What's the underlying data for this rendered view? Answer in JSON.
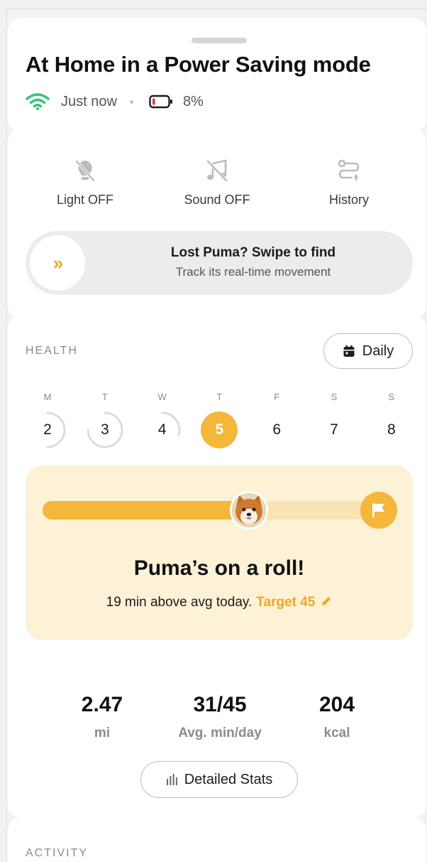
{
  "header": {
    "title": "At Home in a Power Saving mode",
    "updated": "Just now",
    "battery": "8%"
  },
  "controls": [
    {
      "label": "Light OFF",
      "icon": "light-off-icon"
    },
    {
      "label": "Sound OFF",
      "icon": "sound-off-icon"
    },
    {
      "label": "History",
      "icon": "history-icon"
    }
  ],
  "swipe": {
    "title": "Lost Puma? Swipe to find",
    "subtitle": "Track its real-time movement",
    "arrows": "»"
  },
  "health": {
    "label": "HEALTH",
    "period_button": "Daily",
    "days": [
      {
        "dow": "M",
        "num": "2",
        "progress": 0.5
      },
      {
        "dow": "T",
        "num": "3",
        "progress": 0.75
      },
      {
        "dow": "W",
        "num": "4",
        "progress": 0.3
      },
      {
        "dow": "T",
        "num": "5",
        "progress": 1.0,
        "active": true
      },
      {
        "dow": "F",
        "num": "6",
        "progress": 0
      },
      {
        "dow": "S",
        "num": "7",
        "progress": 0
      },
      {
        "dow": "S",
        "num": "8",
        "progress": 0
      }
    ],
    "goal_progress": 0.62,
    "roll_title": "Puma’s on a roll!",
    "roll_subtitle": "19 min above avg today.",
    "target": "Target 45",
    "stats": [
      {
        "value": "2.47",
        "unit": "mi"
      },
      {
        "value": "31/45",
        "unit": "Avg. min/day"
      },
      {
        "value": "204",
        "unit": "kcal"
      }
    ],
    "detail_button": "Detailed Stats"
  },
  "activity": {
    "label": "ACTIVITY"
  },
  "colors": {
    "accent": "#f4b73a",
    "accent_text": "#f0a81f",
    "wifi": "#3cc37a",
    "battery_low": "#e0393e",
    "roll_bg": "#fdf1d6"
  }
}
